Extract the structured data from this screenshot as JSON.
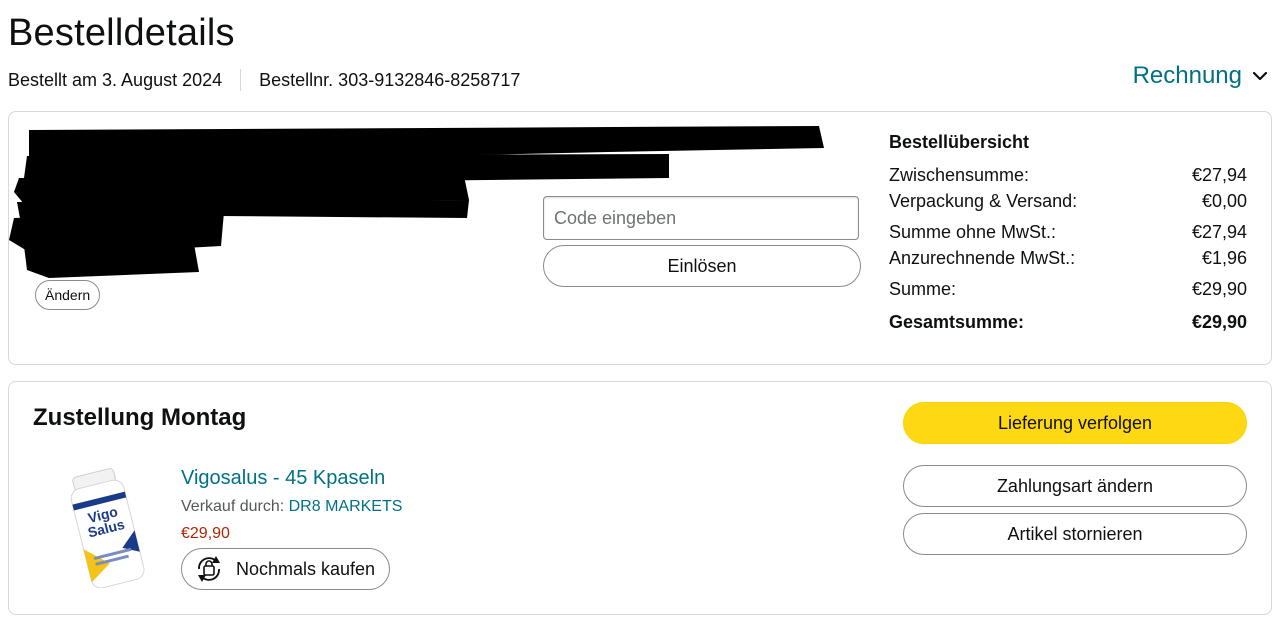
{
  "header": {
    "title": "Bestelldetails",
    "order_date": "Bestellt am 3. August 2024",
    "order_number": "Bestellnr. 303-9132846-8258717",
    "invoice_label": "Rechnung"
  },
  "payment": {
    "change_label": "Ändern",
    "code_placeholder": "Code eingeben",
    "redeem_label": "Einlösen"
  },
  "order_summary": {
    "title": "Bestellübersicht",
    "rows": [
      {
        "label": "Zwischensumme:",
        "value": "€27,94"
      },
      {
        "label": "Verpackung & Versand:",
        "value": "€0,00"
      },
      {
        "label": "Summe ohne MwSt.:",
        "value": "€27,94"
      },
      {
        "label": "Anzurechnende MwSt.:",
        "value": "€1,96"
      },
      {
        "label": "Summe:",
        "value": "€29,90"
      },
      {
        "label": "Gesamtsumme:",
        "value": "€29,90"
      }
    ]
  },
  "delivery": {
    "title": "Zustellung Montag",
    "product": {
      "name": "Vigosalus - 45 Kpaseln",
      "seller_prefix": "Verkauf durch: ",
      "seller": "DR8 MARKETS",
      "price": "€29,90",
      "buy_again_label": "Nochmals kaufen",
      "image_label_line1": "Vigo",
      "image_label_line2": "Salus"
    },
    "actions": {
      "track": "Lieferung verfolgen",
      "change_payment": "Zahlungsart ändern",
      "cancel": "Artikel stornieren"
    }
  },
  "colors": {
    "link": "#007185",
    "price": "#b12704",
    "primary_button": "#ffd814",
    "border": "#d5d9d9"
  }
}
